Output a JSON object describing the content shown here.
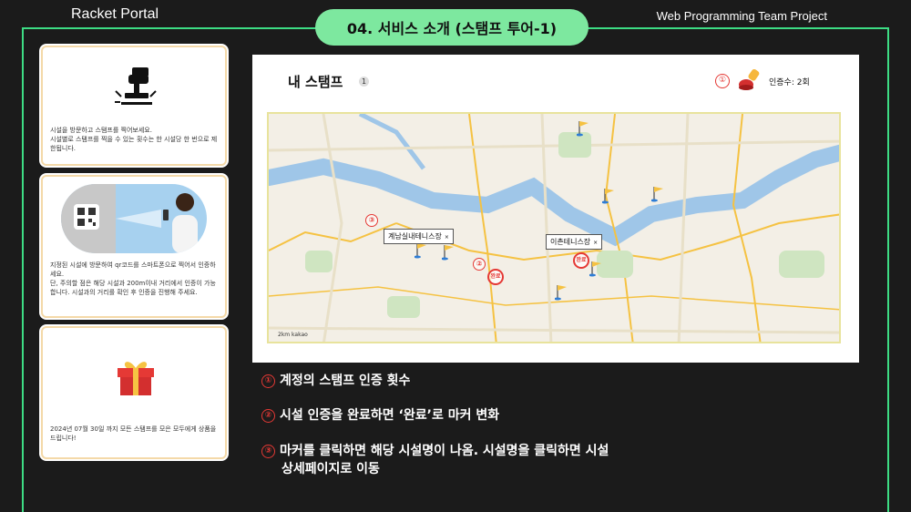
{
  "header": {
    "brand": "Racket Portal",
    "title": "04. 서비스 소개 (스탬프 투어-1)",
    "project": "Web Programming Team Project"
  },
  "sidebar": {
    "cards": [
      {
        "desc": "시설을 방문하고 스탬프를 찍어보세요.\n시설별로 스탬프를 찍을 수 있는 횟수는 한 시설당 한 번으로 제한됩니다.",
        "icon": "stamp-icon"
      },
      {
        "desc": "지정된 시설에 방문하여 qr코드를 스마트폰으로 찍어서 인증하세요.\n단, 주의할 점은 해당 시설과 200m이내 거리에서 인증이 가능합니다. 시설과의 거리를 확인 후 인증을 진행해 주세요.",
        "icon": "qr-scan-icon"
      },
      {
        "desc": "2024년 07월 30일 까지 모든 스탬프를 모은 모두에게 상품을 드립니다!",
        "icon": "gift-icon"
      }
    ]
  },
  "map_panel": {
    "title": "내 스탬프",
    "title_count": "1",
    "cert_marker": "①",
    "cert_text": "인증수: 2회",
    "labels": [
      {
        "text": "계남실내테니스장",
        "close": "×"
      },
      {
        "text": "이촌테니스장",
        "close": "×"
      }
    ],
    "markers": [
      "②",
      "③"
    ],
    "done_text": "완료",
    "kakao": "2km kakao"
  },
  "notes": [
    {
      "num": "①",
      "text": "계정의 스탬프 인증 횟수"
    },
    {
      "num": "②",
      "text": "시설 인증을 완료하면 ‘완료’로 마커 변화"
    },
    {
      "num": "③",
      "text": "마커를 클릭하면 해당 시설명이 나옴. 시설명을 클릭하면 시설",
      "cont": "상세페이지로 이동"
    }
  ],
  "colors": {
    "accent": "#3ddc84",
    "pill": "#7de89f",
    "marker": "#e53935",
    "river": "#9fc6e8"
  }
}
